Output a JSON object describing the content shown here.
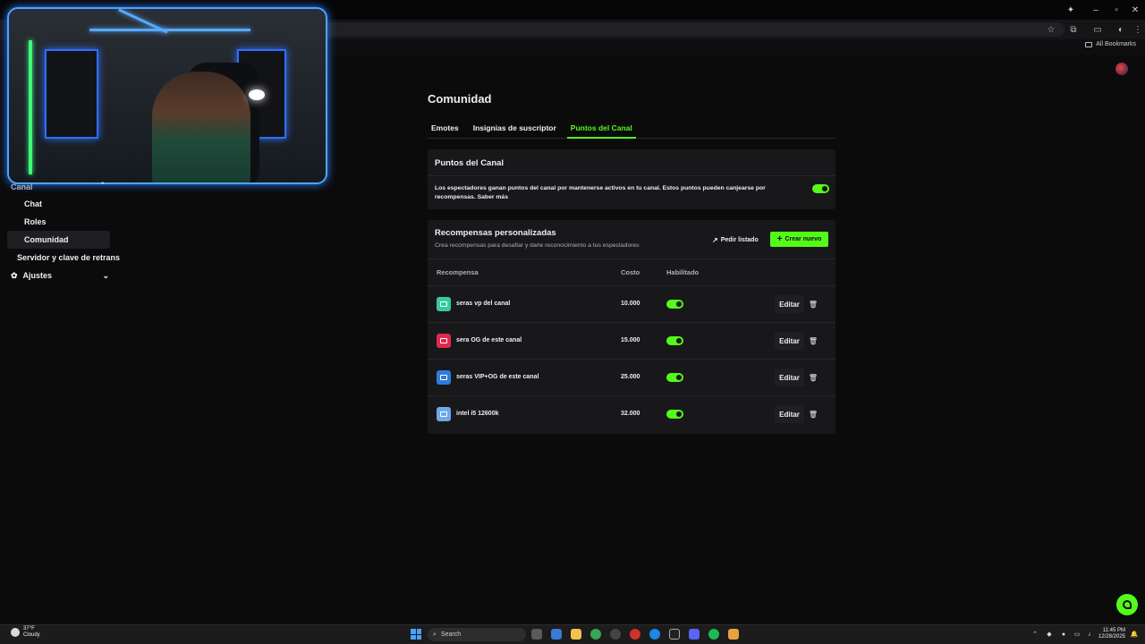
{
  "browser": {
    "bookmarks_label": "All Bookmarks"
  },
  "sidebar": {
    "items": [
      {
        "label": "Canal"
      },
      {
        "label": "Chat"
      },
      {
        "label": "Roles"
      },
      {
        "label": "Comunidad"
      },
      {
        "label": "Servidor y clave de retrans"
      },
      {
        "label": "Ajustes"
      }
    ]
  },
  "main": {
    "title": "Comunidad",
    "tabs": [
      {
        "label": "Emotes"
      },
      {
        "label": "Insignias de suscriptor"
      },
      {
        "label": "Puntos del Canal"
      }
    ],
    "points_card": {
      "title": "Puntos del Canal",
      "description": "Los espectadores ganan puntos del canal por mantenerse activos en tu canal. Estos puntos pueden canjearse por recompensas. Saber más",
      "enabled": true
    },
    "rewards": {
      "title": "Recompensas personalizadas",
      "subtitle": "Crea recompensas para desafiar y darle reconocimiento a tus espectadores",
      "request_list_label": "Pedir listado",
      "create_label": "Crear nuevo",
      "columns": [
        "Recompensa",
        "Costo",
        "Habilitado"
      ],
      "rows": [
        {
          "name": "seras vp del canal",
          "cost": "10.000",
          "enabled": true,
          "color": "#38c9a0",
          "edit_label": "Editar"
        },
        {
          "name": "sera OG de este canal",
          "cost": "15.000",
          "enabled": true,
          "color": "#e0294b",
          "edit_label": "Editar"
        },
        {
          "name": "seras VIP+OG de este canal",
          "cost": "25.000",
          "enabled": true,
          "color": "#2f7bd9",
          "edit_label": "Editar"
        },
        {
          "name": "intel i5 12600k",
          "cost": "32.000",
          "enabled": true,
          "color": "#6fa8e8",
          "edit_label": "Editar"
        }
      ]
    }
  },
  "taskbar": {
    "weather_temp": "37°F",
    "weather_desc": "Cloudy",
    "search_label": "Search",
    "time": "11:45 PM",
    "date": "12/28/2025"
  },
  "colors": {
    "accent": "#53fc18",
    "background": "#0b0b0c",
    "card": "#18181b"
  }
}
